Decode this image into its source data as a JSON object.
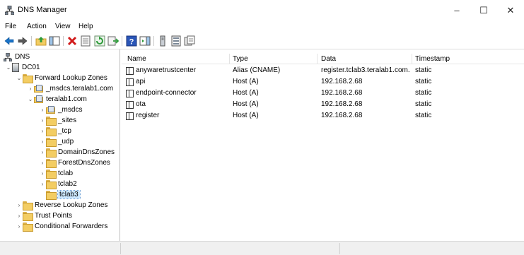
{
  "window": {
    "title": "DNS Manager",
    "minimize_icon": "minimize-icon",
    "maximize_icon": "maximize-icon",
    "close_icon": "close-icon"
  },
  "menu": [
    "File",
    "Action",
    "View",
    "Help"
  ],
  "toolbar": [
    "back-arrow-icon",
    "forward-arrow-icon",
    "up-folder-icon",
    "show-hide-tree-icon",
    "delete-icon",
    "properties-icon",
    "refresh-icon",
    "export-list-icon",
    "help-icon",
    "action-pane-icon",
    "server-icon",
    "list-view-icon",
    "records-icon"
  ],
  "tree": {
    "root": "DNS",
    "server": "DC01",
    "forward_zones": "Forward Lookup Zones",
    "msdcs_zone": "_msdcs.teralab1.com",
    "teralab_zone": "teralab1.com",
    "children": [
      "_msdcs",
      "_sites",
      "_tcp",
      "_udp",
      "DomainDnsZones",
      "ForestDnsZones",
      "tclab",
      "tclab2",
      "tclab3"
    ],
    "selected": "tclab3",
    "reverse_zones": "Reverse Lookup Zones",
    "trust_points": "Trust Points",
    "conditional_forwarders": "Conditional Forwarders"
  },
  "list": {
    "columns": [
      "Name",
      "Type",
      "Data",
      "Timestamp"
    ],
    "rows": [
      {
        "name": "anywaretrustcenter",
        "type": "Alias (CNAME)",
        "data": "register.tclab3.teralab1.com.",
        "timestamp": "static"
      },
      {
        "name": "api",
        "type": "Host (A)",
        "data": "192.168.2.68",
        "timestamp": "static"
      },
      {
        "name": "endpoint-connector",
        "type": "Host (A)",
        "data": "192.168.2.68",
        "timestamp": "static"
      },
      {
        "name": "ota",
        "type": "Host (A)",
        "data": "192.168.2.68",
        "timestamp": "static"
      },
      {
        "name": "register",
        "type": "Host (A)",
        "data": "192.168.2.68",
        "timestamp": "static"
      }
    ]
  },
  "colors": {
    "selection": "#cce8ff",
    "folder": "#f3cd63",
    "status_bar": "#f0f0f0"
  }
}
